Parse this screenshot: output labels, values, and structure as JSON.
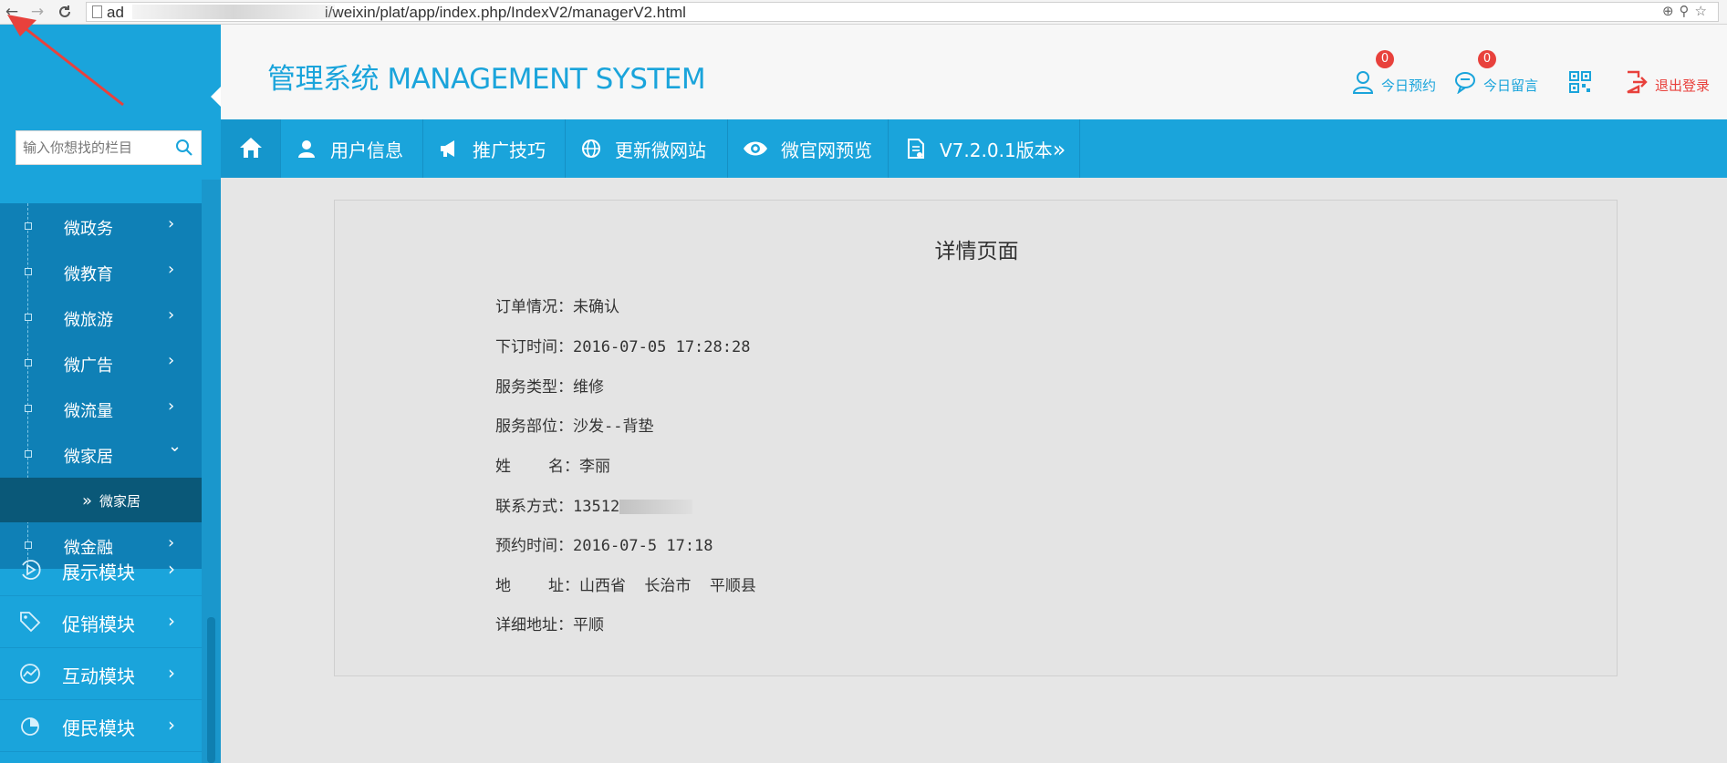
{
  "browser": {
    "url_prefix": "ad",
    "url_rest": "i/weixin/plat/app/index.php/IndexV2/managerV2.html",
    "back_glyph": "←",
    "forward_glyph": "→",
    "reload_glyph": "C"
  },
  "sidebar": {
    "search_placeholder": "输入你想找的栏目",
    "sub_items": [
      {
        "label": "微政务",
        "chevron": "›"
      },
      {
        "label": "微教育",
        "chevron": "›"
      },
      {
        "label": "微旅游",
        "chevron": "›"
      },
      {
        "label": "微广告",
        "chevron": "›"
      },
      {
        "label": "微流量",
        "chevron": "›"
      },
      {
        "label": "微家居",
        "chevron": "⌄"
      }
    ],
    "active_sub_sub": {
      "prefix": "»",
      "label": "微家居"
    },
    "finance_item": {
      "label": "微金融",
      "chevron": "›"
    },
    "modules": [
      {
        "label": "展示模块",
        "icon": "play-circle-icon"
      },
      {
        "label": "促销模块",
        "icon": "tag-icon"
      },
      {
        "label": "互动模块",
        "icon": "chart-circle-icon"
      },
      {
        "label": "便民模块",
        "icon": "pie-circle-icon"
      }
    ],
    "module_chevron": "›"
  },
  "header": {
    "title": "管理系统 MANAGEMENT SYSTEM",
    "appointments_label": "今日预约",
    "appointments_count": "0",
    "messages_label": "今日留言",
    "messages_count": "0",
    "logout_label": "退出登录",
    "accent_color": "#1aa4db",
    "logout_color": "#e8413c"
  },
  "topnav": {
    "items": [
      {
        "label": "用户信息",
        "icon": "user-icon"
      },
      {
        "label": "推广技巧",
        "icon": "megaphone-icon"
      },
      {
        "label": "更新微网站",
        "icon": "globe-icon"
      },
      {
        "label": "微官网预览",
        "icon": "eye-icon"
      },
      {
        "label": "V7.2.0.1版本",
        "icon": "document-icon"
      }
    ],
    "version_suffix": "»"
  },
  "detail": {
    "title": "详情页面",
    "rows": [
      {
        "key": "订单情况：",
        "value": "未确认"
      },
      {
        "key": "下订时间：",
        "value": "2016-07-05 17:28:28"
      },
      {
        "key": "服务类型：",
        "value": "维修"
      },
      {
        "key": "服务部位：",
        "value": "沙发--背垫"
      },
      {
        "key": "姓    名：",
        "value": "李丽"
      },
      {
        "key": "联系方式：",
        "value": "13512"
      },
      {
        "key": "预约时间：",
        "value": "2016-07-5 17:18"
      },
      {
        "key": "地    址：",
        "value": "山西省  长治市  平顺县"
      },
      {
        "key": "详细地址：",
        "value": "平顺"
      }
    ]
  }
}
